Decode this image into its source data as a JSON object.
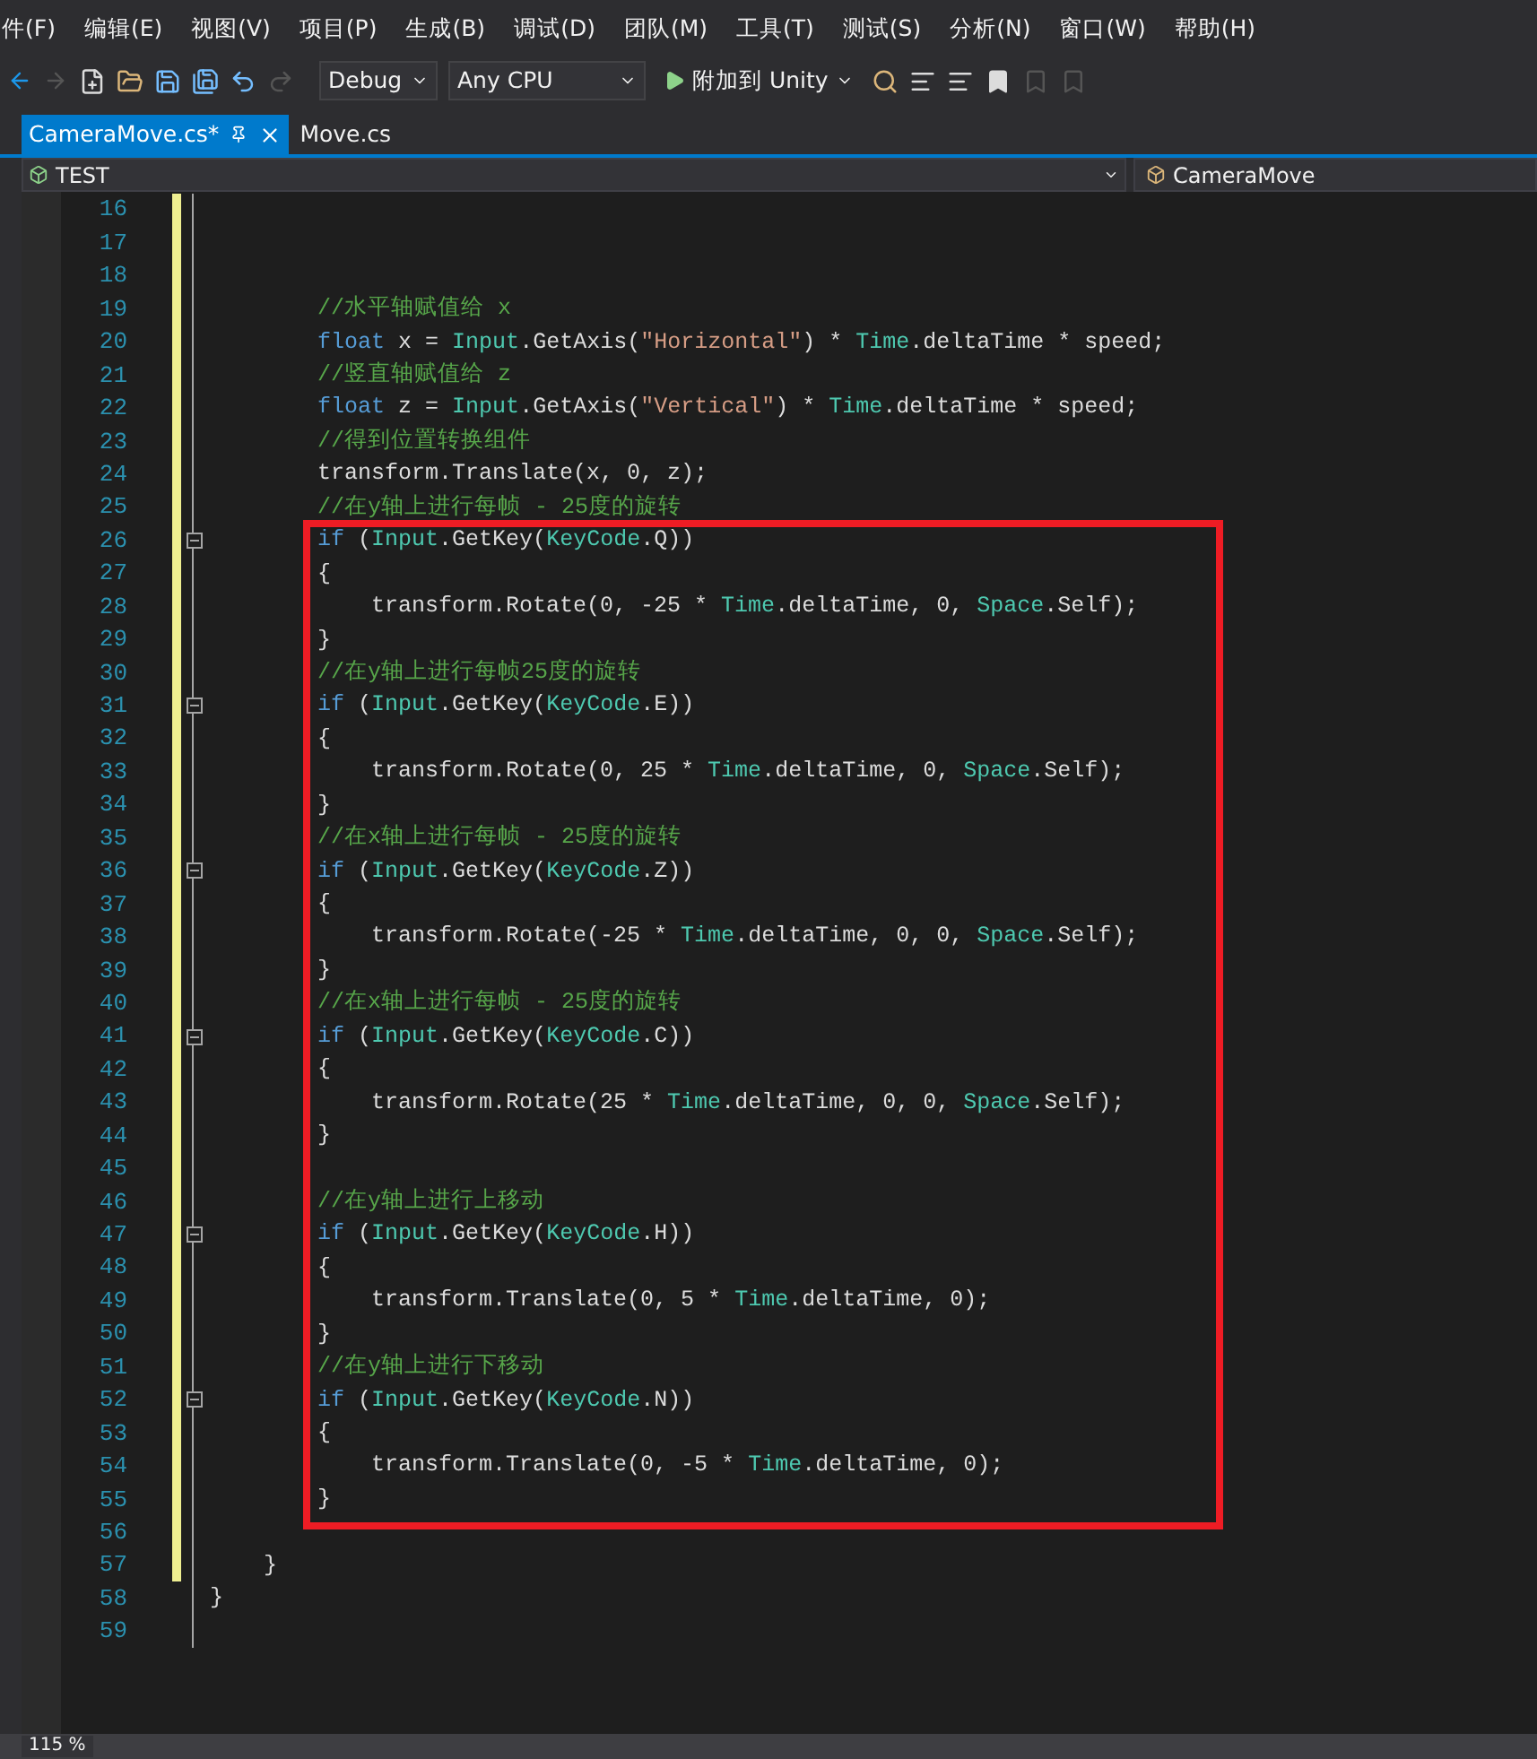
{
  "menu": [
    "件(F)",
    "编辑(E)",
    "视图(V)",
    "项目(P)",
    "生成(B)",
    "调试(D)",
    "团队(M)",
    "工具(T)",
    "测试(S)",
    "分析(N)",
    "窗口(W)",
    "帮助(H)"
  ],
  "toolbar": {
    "configuration": "Debug",
    "platform": "Any CPU",
    "run_label": "附加到 Unity"
  },
  "tabs": [
    {
      "label": "CameraMove.cs*",
      "selected": true
    },
    {
      "label": "Move.cs",
      "selected": false
    }
  ],
  "navigation": {
    "project": "TEST",
    "type": "CameraMove"
  },
  "code_lines": [
    {
      "number": "16",
      "changed": true,
      "foldable": false
    },
    {
      "number": "17",
      "changed": true,
      "foldable": false
    },
    {
      "number": "18",
      "changed": true,
      "foldable": false
    },
    {
      "number": "19",
      "changed": true,
      "foldable": false,
      "tokens": [
        {
          "text": "        //水平轴赋值给 x",
          "kind": "comment"
        }
      ]
    },
    {
      "number": "20",
      "changed": true,
      "foldable": false,
      "tokens": [
        {
          "text": "        float",
          "kind": "keyword"
        },
        {
          "text": " x = ",
          "kind": "plain"
        },
        {
          "text": "Input",
          "kind": "type"
        },
        {
          "text": ".GetAxis(",
          "kind": "plain"
        },
        {
          "text": "\"Horizontal\"",
          "kind": "string"
        },
        {
          "text": ") * ",
          "kind": "plain"
        },
        {
          "text": "Time",
          "kind": "type"
        },
        {
          "text": ".deltaTime * speed;",
          "kind": "plain"
        }
      ]
    },
    {
      "number": "21",
      "changed": true,
      "foldable": false,
      "tokens": [
        {
          "text": "        //竖直轴赋值给 z",
          "kind": "comment"
        }
      ]
    },
    {
      "number": "22",
      "changed": true,
      "foldable": false,
      "tokens": [
        {
          "text": "        float",
          "kind": "keyword"
        },
        {
          "text": " z = ",
          "kind": "plain"
        },
        {
          "text": "Input",
          "kind": "type"
        },
        {
          "text": ".GetAxis(",
          "kind": "plain"
        },
        {
          "text": "\"Vertical\"",
          "kind": "string"
        },
        {
          "text": ") * ",
          "kind": "plain"
        },
        {
          "text": "Time",
          "kind": "type"
        },
        {
          "text": ".deltaTime * speed;",
          "kind": "plain"
        }
      ]
    },
    {
      "number": "23",
      "changed": true,
      "foldable": false,
      "tokens": [
        {
          "text": "        //得到位置转换组件",
          "kind": "comment"
        }
      ]
    },
    {
      "number": "24",
      "changed": true,
      "foldable": false,
      "tokens": [
        {
          "text": "        transform.Translate(x, 0, z);",
          "kind": "plain"
        }
      ]
    },
    {
      "number": "25",
      "changed": true,
      "foldable": false,
      "tokens": [
        {
          "text": "        //在y轴上进行每帧 - 25度的旋转",
          "kind": "comment"
        }
      ]
    },
    {
      "number": "26",
      "changed": true,
      "foldable": true,
      "tokens": [
        {
          "text": "        if",
          "kind": "keyword"
        },
        {
          "text": " (",
          "kind": "plain"
        },
        {
          "text": "Input",
          "kind": "type"
        },
        {
          "text": ".GetKey(",
          "kind": "plain"
        },
        {
          "text": "KeyCode",
          "kind": "type"
        },
        {
          "text": ".Q))",
          "kind": "plain"
        }
      ]
    },
    {
      "number": "27",
      "changed": true,
      "foldable": false,
      "tokens": [
        {
          "text": "        {",
          "kind": "plain"
        }
      ]
    },
    {
      "number": "28",
      "changed": true,
      "foldable": false,
      "tokens": [
        {
          "text": "            transform.Rotate(0, -25 * ",
          "kind": "plain"
        },
        {
          "text": "Time",
          "kind": "type"
        },
        {
          "text": ".deltaTime, 0, ",
          "kind": "plain"
        },
        {
          "text": "Space",
          "kind": "type"
        },
        {
          "text": ".Self);",
          "kind": "plain"
        }
      ]
    },
    {
      "number": "29",
      "changed": true,
      "foldable": false,
      "tokens": [
        {
          "text": "        }",
          "kind": "plain"
        }
      ]
    },
    {
      "number": "30",
      "changed": true,
      "foldable": false,
      "tokens": [
        {
          "text": "        //在y轴上进行每帧25度的旋转",
          "kind": "comment"
        }
      ]
    },
    {
      "number": "31",
      "changed": true,
      "foldable": true,
      "tokens": [
        {
          "text": "        if",
          "kind": "keyword"
        },
        {
          "text": " (",
          "kind": "plain"
        },
        {
          "text": "Input",
          "kind": "type"
        },
        {
          "text": ".GetKey(",
          "kind": "plain"
        },
        {
          "text": "KeyCode",
          "kind": "type"
        },
        {
          "text": ".E))",
          "kind": "plain"
        }
      ]
    },
    {
      "number": "32",
      "changed": true,
      "foldable": false,
      "tokens": [
        {
          "text": "        {",
          "kind": "plain"
        }
      ]
    },
    {
      "number": "33",
      "changed": true,
      "foldable": false,
      "tokens": [
        {
          "text": "            transform.Rotate(0, 25 * ",
          "kind": "plain"
        },
        {
          "text": "Time",
          "kind": "type"
        },
        {
          "text": ".deltaTime, 0, ",
          "kind": "plain"
        },
        {
          "text": "Space",
          "kind": "type"
        },
        {
          "text": ".Self);",
          "kind": "plain"
        }
      ]
    },
    {
      "number": "34",
      "changed": true,
      "foldable": false,
      "tokens": [
        {
          "text": "        }",
          "kind": "plain"
        }
      ]
    },
    {
      "number": "35",
      "changed": true,
      "foldable": false,
      "tokens": [
        {
          "text": "        //在x轴上进行每帧 - 25度的旋转",
          "kind": "comment"
        }
      ]
    },
    {
      "number": "36",
      "changed": true,
      "foldable": true,
      "tokens": [
        {
          "text": "        if",
          "kind": "keyword"
        },
        {
          "text": " (",
          "kind": "plain"
        },
        {
          "text": "Input",
          "kind": "type"
        },
        {
          "text": ".GetKey(",
          "kind": "plain"
        },
        {
          "text": "KeyCode",
          "kind": "type"
        },
        {
          "text": ".Z))",
          "kind": "plain"
        }
      ]
    },
    {
      "number": "37",
      "changed": true,
      "foldable": false,
      "tokens": [
        {
          "text": "        {",
          "kind": "plain"
        }
      ]
    },
    {
      "number": "38",
      "changed": true,
      "foldable": false,
      "tokens": [
        {
          "text": "            transform.Rotate(-25 * ",
          "kind": "plain"
        },
        {
          "text": "Time",
          "kind": "type"
        },
        {
          "text": ".deltaTime, 0, 0, ",
          "kind": "plain"
        },
        {
          "text": "Space",
          "kind": "type"
        },
        {
          "text": ".Self);",
          "kind": "plain"
        }
      ]
    },
    {
      "number": "39",
      "changed": true,
      "foldable": false,
      "tokens": [
        {
          "text": "        }",
          "kind": "plain"
        }
      ]
    },
    {
      "number": "40",
      "changed": true,
      "foldable": false,
      "tokens": [
        {
          "text": "        //在x轴上进行每帧 - 25度的旋转",
          "kind": "comment"
        }
      ]
    },
    {
      "number": "41",
      "changed": true,
      "foldable": true,
      "tokens": [
        {
          "text": "        if",
          "kind": "keyword"
        },
        {
          "text": " (",
          "kind": "plain"
        },
        {
          "text": "Input",
          "kind": "type"
        },
        {
          "text": ".GetKey(",
          "kind": "plain"
        },
        {
          "text": "KeyCode",
          "kind": "type"
        },
        {
          "text": ".C))",
          "kind": "plain"
        }
      ]
    },
    {
      "number": "42",
      "changed": true,
      "foldable": false,
      "tokens": [
        {
          "text": "        {",
          "kind": "plain"
        }
      ]
    },
    {
      "number": "43",
      "changed": true,
      "foldable": false,
      "tokens": [
        {
          "text": "            transform.Rotate(25 * ",
          "kind": "plain"
        },
        {
          "text": "Time",
          "kind": "type"
        },
        {
          "text": ".deltaTime, 0, 0, ",
          "kind": "plain"
        },
        {
          "text": "Space",
          "kind": "type"
        },
        {
          "text": ".Self);",
          "kind": "plain"
        }
      ]
    },
    {
      "number": "44",
      "changed": true,
      "foldable": false,
      "tokens": [
        {
          "text": "        }",
          "kind": "plain"
        }
      ]
    },
    {
      "number": "45",
      "changed": true,
      "foldable": false
    },
    {
      "number": "46",
      "changed": true,
      "foldable": false,
      "tokens": [
        {
          "text": "        //在y轴上进行上移动",
          "kind": "comment"
        }
      ]
    },
    {
      "number": "47",
      "changed": true,
      "foldable": true,
      "tokens": [
        {
          "text": "        if",
          "kind": "keyword"
        },
        {
          "text": " (",
          "kind": "plain"
        },
        {
          "text": "Input",
          "kind": "type"
        },
        {
          "text": ".GetKey(",
          "kind": "plain"
        },
        {
          "text": "KeyCode",
          "kind": "type"
        },
        {
          "text": ".H))",
          "kind": "plain"
        }
      ]
    },
    {
      "number": "48",
      "changed": true,
      "foldable": false,
      "tokens": [
        {
          "text": "        {",
          "kind": "plain"
        }
      ]
    },
    {
      "number": "49",
      "changed": true,
      "foldable": false,
      "tokens": [
        {
          "text": "            transform.Translate(0, 5 * ",
          "kind": "plain"
        },
        {
          "text": "Time",
          "kind": "type"
        },
        {
          "text": ".deltaTime, 0);",
          "kind": "plain"
        }
      ]
    },
    {
      "number": "50",
      "changed": true,
      "foldable": false,
      "tokens": [
        {
          "text": "        }",
          "kind": "plain"
        }
      ]
    },
    {
      "number": "51",
      "changed": true,
      "foldable": false,
      "tokens": [
        {
          "text": "        //在y轴上进行下移动",
          "kind": "comment"
        }
      ]
    },
    {
      "number": "52",
      "changed": true,
      "foldable": true,
      "tokens": [
        {
          "text": "        if",
          "kind": "keyword"
        },
        {
          "text": " (",
          "kind": "plain"
        },
        {
          "text": "Input",
          "kind": "type"
        },
        {
          "text": ".GetKey(",
          "kind": "plain"
        },
        {
          "text": "KeyCode",
          "kind": "type"
        },
        {
          "text": ".N))",
          "kind": "plain"
        }
      ]
    },
    {
      "number": "53",
      "changed": true,
      "foldable": false,
      "tokens": [
        {
          "text": "        {",
          "kind": "plain"
        }
      ]
    },
    {
      "number": "54",
      "changed": true,
      "foldable": false,
      "tokens": [
        {
          "text": "            transform.Translate(0, -5 * ",
          "kind": "plain"
        },
        {
          "text": "Time",
          "kind": "type"
        },
        {
          "text": ".deltaTime, 0);",
          "kind": "plain"
        }
      ]
    },
    {
      "number": "55",
      "changed": true,
      "foldable": false,
      "tokens": [
        {
          "text": "        }",
          "kind": "plain"
        }
      ]
    },
    {
      "number": "56",
      "changed": true,
      "foldable": false
    },
    {
      "number": "57",
      "changed": true,
      "foldable": false,
      "tokens": [
        {
          "text": "    }",
          "kind": "plain"
        }
      ]
    },
    {
      "number": "58",
      "changed": false,
      "foldable": false,
      "tokens": [
        {
          "text": "}",
          "kind": "plain"
        }
      ]
    },
    {
      "number": "59",
      "changed": false,
      "foldable": false
    }
  ],
  "status_bar": {
    "zoom": "115 %"
  }
}
